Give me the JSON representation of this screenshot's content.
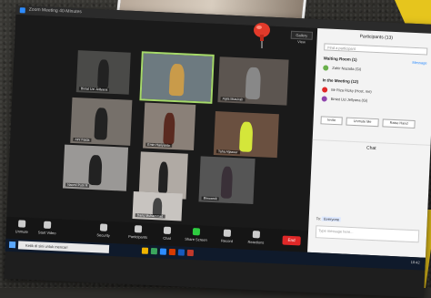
{
  "window": {
    "title": "Zoom Meeting 40-Minutes"
  },
  "gallery": {
    "view_label": "Gallery View",
    "tiles": [
      {
        "name": "Biniat Uzi Jellyana"
      },
      {
        "name": ""
      },
      {
        "name": "Aiyla Mutuirah"
      },
      {
        "name": "Aini Faida"
      },
      {
        "name": "Emin Hariyanto"
      },
      {
        "name": "Taha Aljazeer"
      },
      {
        "name": "Naomi Putri R"
      },
      {
        "name": "Nazira Pemberian"
      },
      {
        "name": "Bimoarek"
      },
      {
        "name": "Zhansha Nazira"
      },
      {
        "name": "Dariq Muhammad"
      }
    ]
  },
  "toolbar": {
    "items": [
      {
        "label": "Unmute",
        "icon": "microphone-icon"
      },
      {
        "label": "Start Video",
        "icon": "video-icon"
      },
      {
        "label": "Security",
        "icon": "shield-icon"
      },
      {
        "label": "Participants",
        "icon": "people-icon"
      },
      {
        "label": "Chat",
        "icon": "chat-icon"
      },
      {
        "label": "Share Screen",
        "icon": "share-icon"
      },
      {
        "label": "Record",
        "icon": "record-icon"
      },
      {
        "label": "Reactions",
        "icon": "smile-icon"
      }
    ],
    "end_label": "End"
  },
  "taskbar": {
    "search_placeholder": "Ketik di sini untuk mencari",
    "time": "10:42"
  },
  "participants": {
    "title": "Participants (13)",
    "find_placeholder": "Find a participant",
    "waiting_title": "Waiting Room (1)",
    "manage_label": "Message",
    "waiting": [
      {
        "name": "Zahir Nazada (Gi)"
      }
    ],
    "in_meeting_title": "In the Meeting (12)",
    "members": [
      {
        "name": "Mr Riza Rizky (Host, me)"
      },
      {
        "name": "Biniat Uzi Jellyana (Gi)"
      }
    ],
    "buttons": [
      "Invite",
      "Unmute Me",
      "Raise Hand"
    ]
  },
  "chat": {
    "title": "Chat",
    "to_label": "To:",
    "to_value": "Everyone",
    "message_placeholder": "Type message here..."
  },
  "colors": {
    "accent": "#2d8cff",
    "end": "#e02828",
    "speaking": "#a6d96a"
  }
}
